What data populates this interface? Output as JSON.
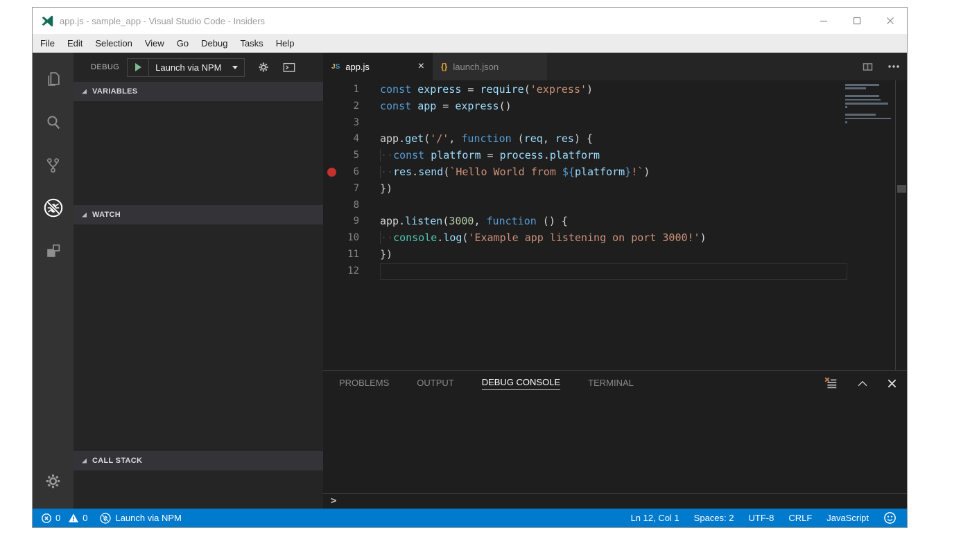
{
  "window": {
    "title": "app.js - sample_app - Visual Studio Code - Insiders",
    "controls": [
      "minimize",
      "maximize",
      "close"
    ]
  },
  "menu": {
    "items": [
      "File",
      "Edit",
      "Selection",
      "View",
      "Go",
      "Debug",
      "Tasks",
      "Help"
    ]
  },
  "activity_bar": {
    "items": [
      {
        "icon": "explorer-files-icon",
        "active": false
      },
      {
        "icon": "search-icon",
        "active": false
      },
      {
        "icon": "source-control-icon",
        "active": false
      },
      {
        "icon": "debug-no-bug-icon",
        "active": true
      },
      {
        "icon": "extensions-icon",
        "active": false
      }
    ],
    "bottom_icon": "settings-gear-icon"
  },
  "debug_sidebar": {
    "title": "DEBUG",
    "launch_config": "Launch via NPM",
    "toolbar_icons": [
      "start-debug-icon",
      "dropdown-caret-icon",
      "configure-gear-icon",
      "open-console-icon"
    ],
    "sections": [
      {
        "label": "VARIABLES"
      },
      {
        "label": "WATCH"
      },
      {
        "label": "CALL STACK"
      }
    ]
  },
  "editor": {
    "tabs": [
      {
        "label": "app.js",
        "icon": "js-file-icon",
        "active": true,
        "close_glyph": "×"
      },
      {
        "label": "launch.json",
        "icon": "json-braces-icon",
        "active": false
      }
    ],
    "actions": [
      "split-editor-icon",
      "more-actions-icon"
    ],
    "lines": [
      {
        "n": 1,
        "tokens": [
          [
            "kw",
            "const"
          ],
          [
            "pn",
            " "
          ],
          [
            "id",
            "express"
          ],
          [
            "pn",
            " = "
          ],
          [
            "id",
            "require"
          ],
          [
            "pn",
            "("
          ],
          [
            "str",
            "'express'"
          ],
          [
            "pn",
            ")"
          ]
        ]
      },
      {
        "n": 2,
        "tokens": [
          [
            "kw",
            "const"
          ],
          [
            "pn",
            " "
          ],
          [
            "id",
            "app"
          ],
          [
            "pn",
            " = "
          ],
          [
            "id",
            "express"
          ],
          [
            "pn",
            "()"
          ]
        ]
      },
      {
        "n": 3,
        "tokens": []
      },
      {
        "n": 4,
        "tokens": [
          [
            "pn",
            "app."
          ],
          [
            "id",
            "get"
          ],
          [
            "pn",
            "("
          ],
          [
            "str",
            "'/'"
          ],
          [
            "pn",
            ", "
          ],
          [
            "kw",
            "function"
          ],
          [
            "pn",
            " ("
          ],
          [
            "id",
            "req"
          ],
          [
            "pn",
            ", "
          ],
          [
            "id",
            "res"
          ],
          [
            "pn",
            ") {"
          ]
        ]
      },
      {
        "n": 5,
        "tokens": [
          [
            "ws",
            "··"
          ],
          [
            "kw",
            "const"
          ],
          [
            "pn",
            " "
          ],
          [
            "id",
            "platform"
          ],
          [
            "pn",
            " = "
          ],
          [
            "id",
            "process"
          ],
          [
            "pn",
            "."
          ],
          [
            "id",
            "platform"
          ]
        ]
      },
      {
        "n": 6,
        "breakpoint": true,
        "tokens": [
          [
            "ws",
            "··"
          ],
          [
            "id",
            "res"
          ],
          [
            "pn",
            "."
          ],
          [
            "id",
            "send"
          ],
          [
            "pn",
            "("
          ],
          [
            "str",
            "`Hello World from "
          ],
          [
            "kw",
            "${"
          ],
          [
            "id",
            "platform"
          ],
          [
            "kw",
            "}"
          ],
          [
            "str",
            "!`"
          ],
          [
            "pn",
            ")"
          ]
        ]
      },
      {
        "n": 7,
        "tokens": [
          [
            "pn",
            "})"
          ]
        ]
      },
      {
        "n": 8,
        "tokens": []
      },
      {
        "n": 9,
        "tokens": [
          [
            "pn",
            "app."
          ],
          [
            "id",
            "listen"
          ],
          [
            "pn",
            "("
          ],
          [
            "num",
            "3000"
          ],
          [
            "pn",
            ", "
          ],
          [
            "kw",
            "function"
          ],
          [
            "pn",
            " () {"
          ]
        ]
      },
      {
        "n": 10,
        "tokens": [
          [
            "ws",
            "··"
          ],
          [
            "cls",
            "console"
          ],
          [
            "pn",
            "."
          ],
          [
            "id",
            "log"
          ],
          [
            "pn",
            "("
          ],
          [
            "str",
            "'Example app listening on port 3000!'"
          ],
          [
            "pn",
            ")"
          ]
        ]
      },
      {
        "n": 11,
        "tokens": [
          [
            "pn",
            "})"
          ]
        ]
      },
      {
        "n": 12,
        "current": true,
        "tokens": []
      }
    ],
    "cursor": {
      "line": 12,
      "col": 1
    }
  },
  "panel": {
    "tabs": [
      {
        "label": "PROBLEMS",
        "active": false
      },
      {
        "label": "OUTPUT",
        "active": false
      },
      {
        "label": "DEBUG CONSOLE",
        "active": true
      },
      {
        "label": "TERMINAL",
        "active": false
      }
    ],
    "actions": [
      "clear-console-icon",
      "maximize-panel-icon",
      "close-panel-icon"
    ],
    "input_prompt": ">"
  },
  "status_bar": {
    "error_count": "0",
    "warning_count": "0",
    "launch_label": "Launch via NPM",
    "right_items": [
      "Ln 12, Col 1",
      "Spaces: 2",
      "UTF-8",
      "CRLF",
      "JavaScript"
    ],
    "icons": [
      "errors-icon",
      "warnings-icon",
      "debug-no-bug-icon",
      "feedback-smiley-icon"
    ]
  },
  "colors": {
    "accent": "#007acc",
    "editor_bg": "#1e1e1e",
    "sidebar_bg": "#252526",
    "activitybar_bg": "#333333",
    "breakpoint": "#c4312e",
    "keyword": "#569cd6",
    "identifier": "#9cdcfe",
    "string": "#ce9178",
    "number": "#b5cea8",
    "support_class": "#4ec9b0"
  }
}
